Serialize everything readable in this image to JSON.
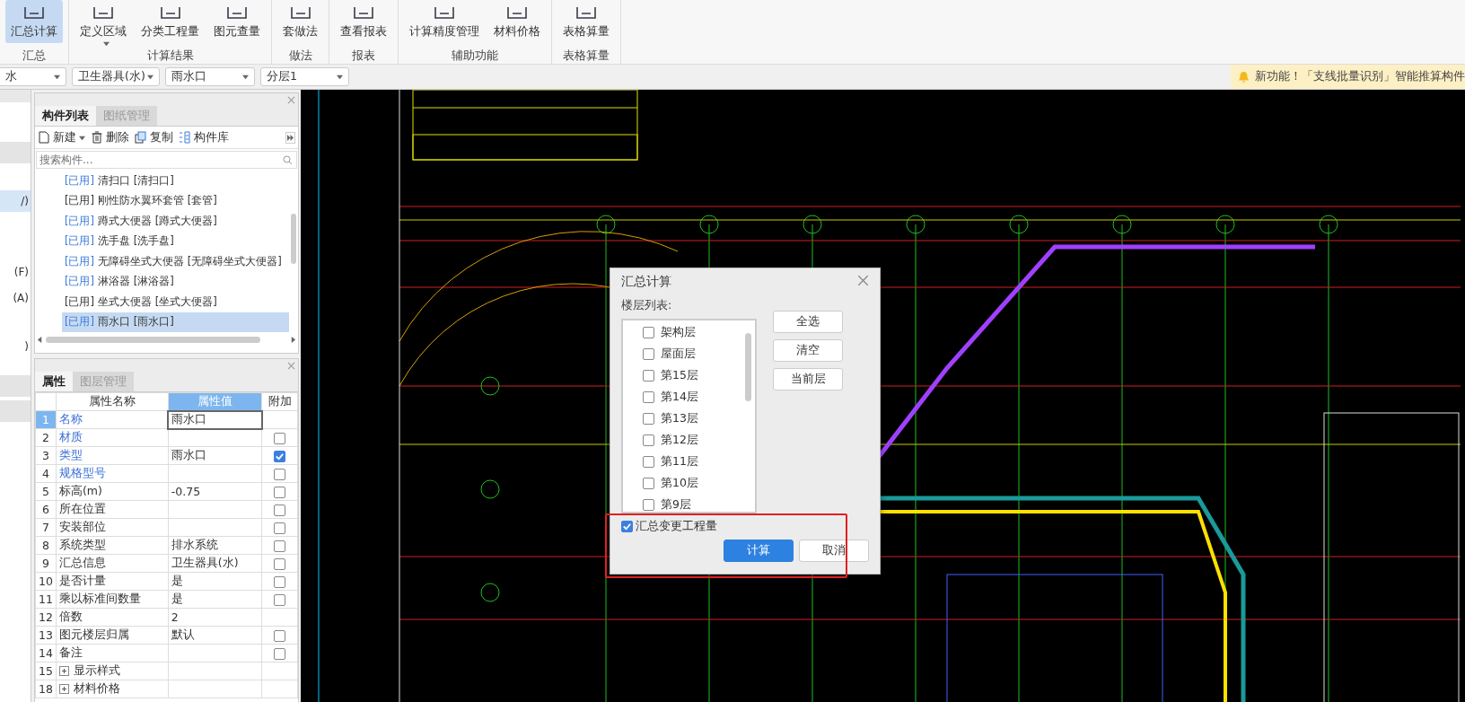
{
  "ribbon": {
    "groups": [
      {
        "label": "汇总",
        "items": [
          {
            "label": "汇总计算",
            "selected": true,
            "dropdown": false
          }
        ]
      },
      {
        "label": "计算结果",
        "items": [
          {
            "label": "定义区域",
            "selected": false,
            "dropdown": true
          },
          {
            "label": "分类工程量",
            "selected": false,
            "dropdown": false
          },
          {
            "label": "图元查量",
            "selected": false,
            "dropdown": false
          }
        ]
      },
      {
        "label": "做法",
        "items": [
          {
            "label": "套做法",
            "selected": false,
            "dropdown": false
          }
        ]
      },
      {
        "label": "报表",
        "items": [
          {
            "label": "查看报表",
            "selected": false,
            "dropdown": false
          }
        ]
      },
      {
        "label": "辅助功能",
        "items": [
          {
            "label": "计算精度管理",
            "selected": false,
            "dropdown": false
          },
          {
            "label": "材料价格",
            "selected": false,
            "dropdown": false
          }
        ]
      },
      {
        "label": "表格算量",
        "items": [
          {
            "label": "表格算量",
            "selected": false,
            "dropdown": false
          }
        ]
      }
    ]
  },
  "selectors": [
    "水",
    "卫生器具(水)",
    "雨水口",
    "分层1"
  ],
  "notice": "新功能！「支线批量识别」智能推算构件",
  "side_panel": {
    "items": [
      {
        "label": "/)",
        "selected": true
      },
      {
        "label": "(F)",
        "selected": false
      },
      {
        "label": "(A)",
        "selected": false
      },
      {
        "label": ")",
        "selected": false
      }
    ]
  },
  "component_panel": {
    "tabs": [
      {
        "label": "构件列表",
        "selected": true
      },
      {
        "label": "图纸管理",
        "selected": false
      }
    ],
    "toolbar": [
      "新建",
      "删除",
      "复制",
      "构件库"
    ],
    "search": {
      "placeholder": "搜索构件..."
    },
    "items": [
      {
        "tag": "[已用]",
        "name": "清扫口 [清扫口]",
        "color": "#3b78d8",
        "selected": false
      },
      {
        "tag": "[已用]",
        "name": "刚性防水翼环套管 [套管]",
        "color": "#333333",
        "selected": false
      },
      {
        "tag": "[已用]",
        "name": "蹲式大便器 [蹲式大便器]",
        "color": "#3b78d8",
        "selected": false
      },
      {
        "tag": "[已用]",
        "name": "洗手盘 [洗手盘]",
        "color": "#3b78d8",
        "selected": false
      },
      {
        "tag": "[已用]",
        "name": "无障碍坐式大便器 [无障碍坐式大便器]",
        "color": "#3b78d8",
        "selected": false
      },
      {
        "tag": "[已用]",
        "name": "淋浴器 [淋浴器]",
        "color": "#3b78d8",
        "selected": false
      },
      {
        "tag": "[已用]",
        "name": "坐式大便器 [坐式大便器]",
        "color": "#333333",
        "selected": false
      },
      {
        "tag": "[已用]",
        "name": "雨水口 [雨水口]",
        "color": "#3b78d8",
        "selected": true
      }
    ]
  },
  "properties_panel": {
    "tabs": [
      {
        "label": "属性",
        "selected": true
      },
      {
        "label": "图层管理",
        "selected": false
      }
    ],
    "columns": [
      "属性名称",
      "属性值",
      "附加"
    ],
    "rows": [
      {
        "num": "1",
        "name": "名称",
        "value": "雨水口",
        "linked": true,
        "selected": true,
        "expander": false,
        "extra": null
      },
      {
        "num": "2",
        "name": "材质",
        "value": "",
        "linked": true,
        "selected": false,
        "expander": false,
        "extra": false
      },
      {
        "num": "3",
        "name": "类型",
        "value": "雨水口",
        "linked": true,
        "selected": false,
        "expander": false,
        "extra": true
      },
      {
        "num": "4",
        "name": "规格型号",
        "value": "",
        "linked": true,
        "selected": false,
        "expander": false,
        "extra": false
      },
      {
        "num": "5",
        "name": "标高(m)",
        "value": "-0.75",
        "linked": false,
        "selected": false,
        "expander": false,
        "extra": false
      },
      {
        "num": "6",
        "name": "所在位置",
        "value": "",
        "linked": false,
        "selected": false,
        "expander": false,
        "extra": false
      },
      {
        "num": "7",
        "name": "安装部位",
        "value": "",
        "linked": false,
        "selected": false,
        "expander": false,
        "extra": false
      },
      {
        "num": "8",
        "name": "系统类型",
        "value": "排水系统",
        "linked": false,
        "selected": false,
        "expander": false,
        "extra": false
      },
      {
        "num": "9",
        "name": "汇总信息",
        "value": "卫生器具(水)",
        "linked": false,
        "selected": false,
        "expander": false,
        "extra": false
      },
      {
        "num": "10",
        "name": "是否计量",
        "value": "是",
        "linked": false,
        "selected": false,
        "expander": false,
        "extra": false
      },
      {
        "num": "11",
        "name": "乘以标准间数量",
        "value": "是",
        "linked": false,
        "selected": false,
        "expander": false,
        "extra": false
      },
      {
        "num": "12",
        "name": "倍数",
        "value": "2",
        "linked": false,
        "selected": false,
        "expander": false,
        "extra": null
      },
      {
        "num": "13",
        "name": "图元楼层归属",
        "value": "默认",
        "linked": false,
        "selected": false,
        "expander": false,
        "extra": false
      },
      {
        "num": "14",
        "name": "备注",
        "value": "",
        "linked": false,
        "selected": false,
        "expander": false,
        "extra": false
      },
      {
        "num": "15",
        "name": "显示样式",
        "value": "",
        "linked": false,
        "selected": false,
        "expander": true,
        "extra": null
      },
      {
        "num": "18",
        "name": "材料价格",
        "value": "",
        "linked": false,
        "selected": false,
        "expander": true,
        "extra": null
      }
    ]
  },
  "dialog": {
    "title": "汇总计算",
    "list_label": "楼层列表:",
    "floors": [
      {
        "label": "架构层",
        "checked": false
      },
      {
        "label": "屋面层",
        "checked": false
      },
      {
        "label": "第15层",
        "checked": false
      },
      {
        "label": "第14层",
        "checked": false
      },
      {
        "label": "第13层",
        "checked": false
      },
      {
        "label": "第12层",
        "checked": false
      },
      {
        "label": "第11层",
        "checked": false
      },
      {
        "label": "第10层",
        "checked": false
      },
      {
        "label": "第9层",
        "checked": false
      }
    ],
    "side_buttons": [
      "全选",
      "清空",
      "当前层"
    ],
    "option": {
      "label": "汇总变更工程量",
      "checked": true
    },
    "buttons": [
      {
        "label": "计算",
        "kind": "primary"
      },
      {
        "label": "取消",
        "kind": "secondary"
      }
    ]
  }
}
